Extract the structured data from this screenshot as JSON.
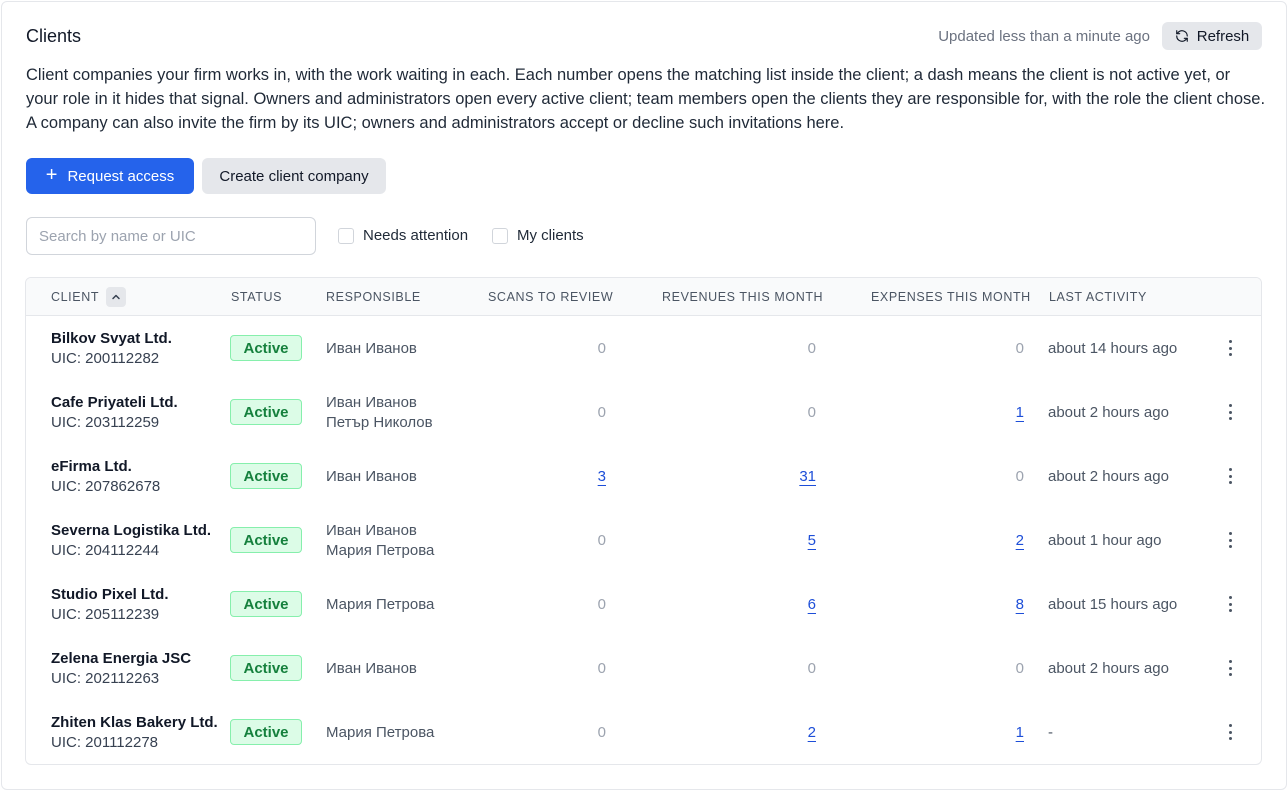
{
  "header": {
    "title": "Clients",
    "updated": "Updated less than a minute ago",
    "refresh_label": "Refresh"
  },
  "description": "Client companies your firm works in, with the work waiting in each. Each number opens the matching list inside the client; a dash means the client is not active yet, or your role in it hides that signal. Owners and administrators open every active client; team members open the clients they are responsible for, with the role the client chose. A company can also invite the firm by its UIC; owners and administrators accept or decline such invitations here.",
  "actions": {
    "request_access": "Request access",
    "create_client": "Create client company"
  },
  "filters": {
    "search_placeholder": "Search by name or UIC",
    "needs_attention": "Needs attention",
    "my_clients": "My clients"
  },
  "table": {
    "columns": {
      "client": "CLIENT",
      "status": "STATUS",
      "responsible": "RESPONSIBLE",
      "scans": "SCANS TO REVIEW",
      "revenues": "REVENUES THIS MONTH",
      "expenses": "EXPENSES THIS MONTH",
      "activity": "LAST ACTIVITY"
    },
    "rows": [
      {
        "name": "Bilkov Svyat Ltd.",
        "uic": "UIC: 200112282",
        "status": "Active",
        "responsible": [
          "Иван Иванов"
        ],
        "scans": "0",
        "revenues": "0",
        "expenses": "0",
        "activity": "about 14 hours ago"
      },
      {
        "name": "Cafe Priyateli Ltd.",
        "uic": "UIC: 203112259",
        "status": "Active",
        "responsible": [
          "Иван Иванов",
          "Петър Николов"
        ],
        "scans": "0",
        "revenues": "0",
        "expenses": "1",
        "activity": "about 2 hours ago"
      },
      {
        "name": "eFirma Ltd.",
        "uic": "UIC: 207862678",
        "status": "Active",
        "responsible": [
          "Иван Иванов"
        ],
        "scans": "3",
        "revenues": "31",
        "expenses": "0",
        "activity": "about 2 hours ago"
      },
      {
        "name": "Severna Logistika Ltd.",
        "uic": "UIC: 204112244",
        "status": "Active",
        "responsible": [
          "Иван Иванов",
          "Мария Петрова"
        ],
        "scans": "0",
        "revenues": "5",
        "expenses": "2",
        "activity": "about 1 hour ago"
      },
      {
        "name": "Studio Pixel Ltd.",
        "uic": "UIC: 205112239",
        "status": "Active",
        "responsible": [
          "Мария Петрова"
        ],
        "scans": "0",
        "revenues": "6",
        "expenses": "8",
        "activity": "about 15 hours ago"
      },
      {
        "name": "Zelena Energia JSC",
        "uic": "UIC: 202112263",
        "status": "Active",
        "responsible": [
          "Иван Иванов"
        ],
        "scans": "0",
        "revenues": "0",
        "expenses": "0",
        "activity": "about 2 hours ago"
      },
      {
        "name": "Zhiten Klas Bakery Ltd.",
        "uic": "UIC: 201112278",
        "status": "Active",
        "responsible": [
          "Мария Петрова"
        ],
        "scans": "0",
        "revenues": "2",
        "expenses": "1",
        "activity": "-"
      }
    ]
  },
  "colors": {
    "primary": "#2563eb",
    "link": "#1d4ed8",
    "badge_bg": "#dcfce7",
    "badge_text": "#15803d"
  },
  "icons": {
    "refresh": "refresh-icon",
    "plus": "plus-icon",
    "sort": "chevron-up-icon",
    "row_menu": "more-vertical-icon"
  }
}
